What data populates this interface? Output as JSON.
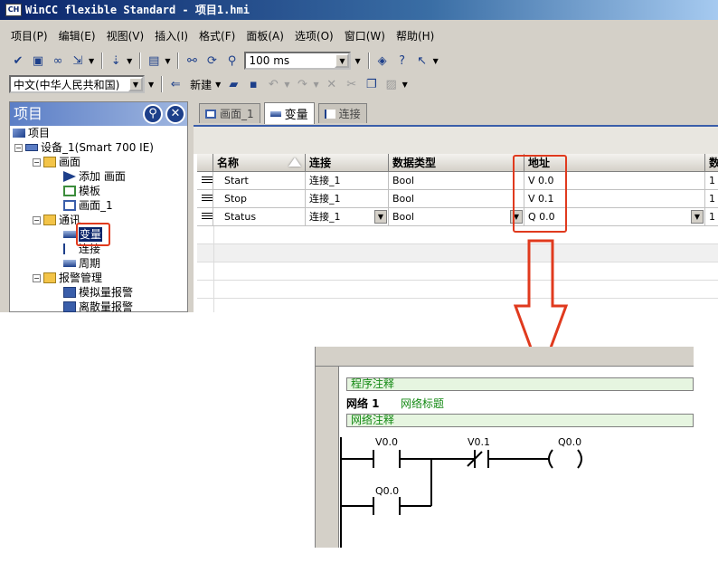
{
  "window": {
    "title": "WinCC flexible Standard - 项目1.hmi",
    "icon_label": "CH"
  },
  "menu": [
    "项目(P)",
    "编辑(E)",
    "视图(V)",
    "插入(I)",
    "格式(F)",
    "面板(A)",
    "选项(O)",
    "窗口(W)",
    "帮助(H)"
  ],
  "toolbar": {
    "cycle_value": "100 ms",
    "language_value": "中文(中华人民共和国)",
    "new_label": "新建"
  },
  "project_panel": {
    "title": "项目",
    "tree": {
      "root": "项目",
      "device": "设备_1(Smart 700 IE)",
      "screens": "画面",
      "add_screen": "添加 画面",
      "template": "模板",
      "screen_1": "画面_1",
      "comm": "通讯",
      "tags": "变量",
      "connections": "连接",
      "cycles": "周期",
      "alarm_mgmt": "报警管理",
      "analog_alarms": "模拟量报警",
      "discrete_alarms": "离散量报警"
    }
  },
  "editor": {
    "tabs": [
      "画面_1",
      "变量",
      "连接"
    ],
    "columns": [
      "名称",
      "连接",
      "数据类型",
      "地址",
      "数"
    ],
    "rows": [
      {
        "name": "Start",
        "connection": "连接_1",
        "type": "Bool",
        "address": "V 0.0",
        "extra": "1"
      },
      {
        "name": "Stop",
        "connection": "连接_1",
        "type": "Bool",
        "address": "V 0.1",
        "extra": "1"
      },
      {
        "name": "Status",
        "connection": "连接_1",
        "type": "Bool",
        "address": "Q 0.0",
        "extra": "1"
      }
    ]
  },
  "ladder": {
    "program_comment": "程序注释",
    "network_label": "网络 1",
    "network_title": "网络标题",
    "network_comment": "网络注释",
    "contact1": "V0.0",
    "contact2": "V0.1",
    "coil": "Q0.0",
    "parallel_contact": "Q0.0"
  },
  "colors": {
    "highlight_box": "#e03a1e",
    "comment_text": "#148a14",
    "title_bar": "#0a246a"
  }
}
